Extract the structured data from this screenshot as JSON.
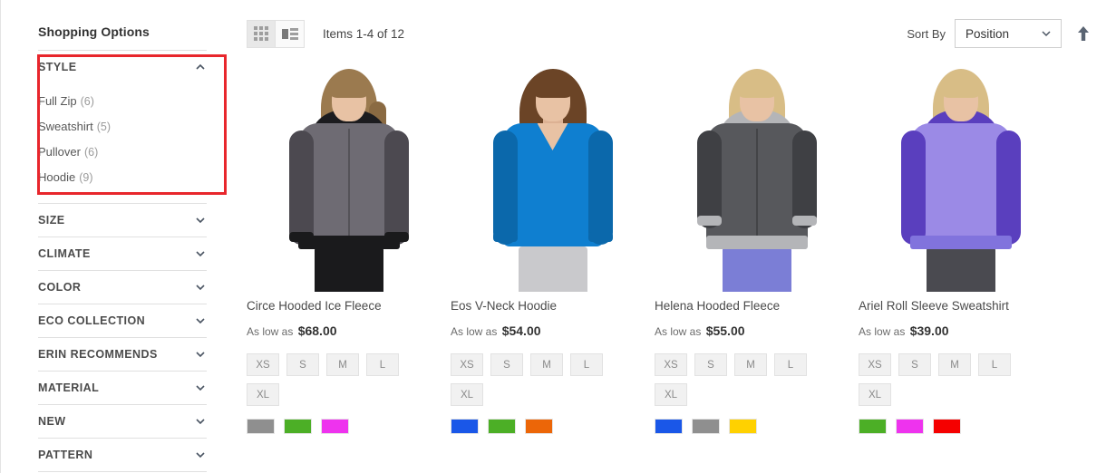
{
  "sidebar": {
    "title": "Shopping Options",
    "style_filter": {
      "label": "STYLE",
      "expanded": true,
      "chevron": "chevron-up-icon",
      "options": [
        {
          "label": "Full Zip",
          "count": "(6)"
        },
        {
          "label": "Sweatshirt",
          "count": "(5)"
        },
        {
          "label": "Pullover",
          "count": "(6)"
        },
        {
          "label": "Hoodie",
          "count": "(9)"
        }
      ]
    },
    "filters": [
      {
        "label": "SIZE",
        "chevron": "chevron-down-icon"
      },
      {
        "label": "CLIMATE",
        "chevron": "chevron-down-icon"
      },
      {
        "label": "COLOR",
        "chevron": "chevron-down-icon"
      },
      {
        "label": "ECO COLLECTION",
        "chevron": "chevron-down-icon"
      },
      {
        "label": "ERIN RECOMMENDS",
        "chevron": "chevron-down-icon"
      },
      {
        "label": "MATERIAL",
        "chevron": "chevron-down-icon"
      },
      {
        "label": "NEW",
        "chevron": "chevron-down-icon"
      },
      {
        "label": "PATTERN",
        "chevron": "chevron-down-icon"
      }
    ]
  },
  "toolbar": {
    "grid_view_icon": "grid-view-icon",
    "list_view_icon": "list-view-icon",
    "active_view": "grid",
    "items_count": "Items 1-4 of 12",
    "sort_label": "Sort By",
    "sort_value": "Position",
    "sort_chevron": "chevron-down-icon",
    "sort_direction_icon": "sort-ascending-arrow-icon"
  },
  "annotation": {
    "color": "#e8262c",
    "target": "style-filter"
  },
  "price_prefix": "As low as",
  "products": [
    {
      "name": "Circe Hooded Ice Fleece",
      "price": "$68.00",
      "sizes": [
        "XS",
        "S",
        "M",
        "L",
        "XL"
      ],
      "swatches": [
        "#8f8f8f",
        "#4caf26",
        "#ee33ee"
      ],
      "photo": {
        "garment": "#6e6b73",
        "garment_dark": "#4c4950",
        "hood": "#1c1c1f",
        "hair": "#9b7a4f",
        "bottoms": "#1a1a1c",
        "neckline": "zip"
      }
    },
    {
      "name": "Eos V-Neck Hoodie",
      "price": "$54.00",
      "sizes": [
        "XS",
        "S",
        "M",
        "L",
        "XL"
      ],
      "swatches": [
        "#1a57e8",
        "#4caf26",
        "#ec6608"
      ],
      "photo": {
        "garment": "#0f7fd0",
        "garment_dark": "#0b68ab",
        "hood": "#0f7fd0",
        "hair": "#6b4426",
        "bottoms": "#c9c9cc",
        "neckline": "vneck"
      }
    },
    {
      "name": "Helena Hooded Fleece",
      "price": "$55.00",
      "sizes": [
        "XS",
        "S",
        "M",
        "L",
        "XL"
      ],
      "swatches": [
        "#1a57e8",
        "#8f8f8f",
        "#ffd100"
      ],
      "photo": {
        "garment": "#57585c",
        "garment_dark": "#3f4044",
        "hood": "#b4b5b8",
        "hair": "#d8bd86",
        "bottoms": "#7b7ed6",
        "neckline": "zip"
      }
    },
    {
      "name": "Ariel Roll Sleeve Sweatshirt",
      "price": "$39.00",
      "sizes": [
        "XS",
        "S",
        "M",
        "L",
        "XL"
      ],
      "swatches": [
        "#4caf26",
        "#ee33ee",
        "#f50000"
      ],
      "photo": {
        "garment": "#9b8ae6",
        "garment_dark": "#8173dd",
        "hood": "#5a3fbe",
        "hair": "#d8bd86",
        "bottoms": "#4a4a50",
        "neckline": "hoodneck"
      }
    }
  ]
}
